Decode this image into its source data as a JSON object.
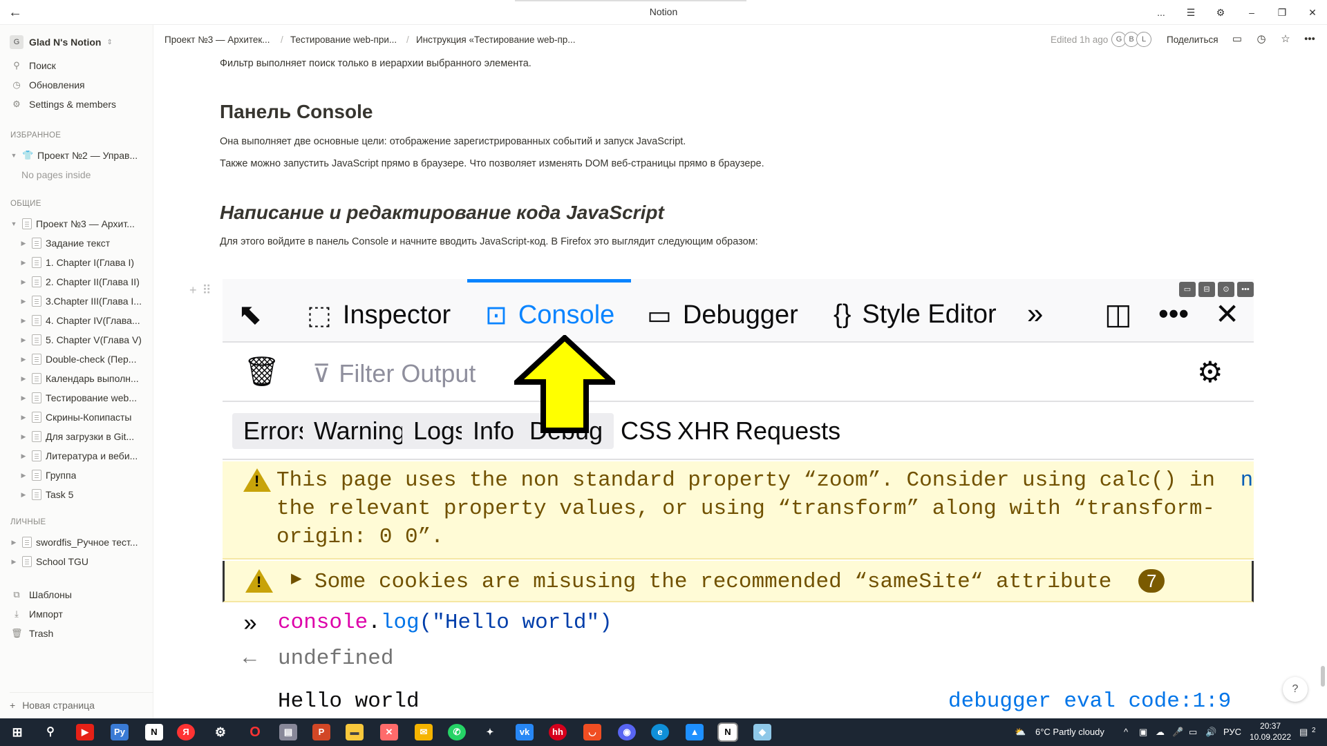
{
  "window": {
    "title": "Notion",
    "controls": [
      "...",
      "☰",
      "⚙",
      "–",
      "❐",
      "✕"
    ]
  },
  "sidebar": {
    "workspace_initial": "G",
    "workspace_name": "Glad N's Notion",
    "nav": [
      {
        "label": "Поиск",
        "icon": "search-icon"
      },
      {
        "label": "Обновления",
        "icon": "clock-icon"
      },
      {
        "label": "Settings & members",
        "icon": "gear-icon"
      }
    ],
    "favorites_header": "ИЗБРАННОЕ",
    "favorites": [
      {
        "label": "Проект №2 — Управ..."
      }
    ],
    "no_pages": "No pages inside",
    "shared_header": "ОБЩИЕ",
    "shared_root": "Проект №3 — Архит...",
    "shared_children": [
      "Задание текст",
      "1. Chapter I(Глава I)",
      "2. Chapter II(Глава II)",
      "3.Chapter III(Глава I...",
      "4. Chapter IV(Глава...",
      "5. Chapter V(Глава V)",
      "Double-check (Пер...",
      "Календарь выполн...",
      "Тестирование web...",
      "Скрины-Копипасты",
      "Для загрузки в Git...",
      "Литература и веби...",
      "Группа",
      "Task 5"
    ],
    "private_header": "ЛИЧНЫЕ",
    "private": [
      "swordfis_Ручное тест...",
      "School TGU"
    ],
    "bottom": [
      {
        "label": "Шаблоны",
        "icon": "templates-icon"
      },
      {
        "label": "Импорт",
        "icon": "import-icon"
      },
      {
        "label": "Trash",
        "icon": "trash-icon"
      }
    ],
    "new_page": "Новая страница"
  },
  "topbar": {
    "breadcrumbs": [
      "Проект №3 — Архитек...",
      "Тестирование web-при...",
      "Инструкция «Тестирование web-пр..."
    ],
    "separator": "/",
    "edited": "Edited 1h ago",
    "avatars": [
      "G",
      "B",
      "L"
    ],
    "share": "Поделиться"
  },
  "content": {
    "p_filter": "Фильтр выполняет поиск только в иерархии выбранного элемента.",
    "h_console": "Панель Console",
    "p_goals": "Она выполняет две основные цели: отображение зарегистрированных событий и запуск JavaScript.",
    "p_run": "Также можно запустить JavaScript прямо в браузере. Что позволяет изменять DOM веб-страницы прямо в браузере.",
    "h_writing": "Написание и редактирование кода JavaScript",
    "p_firefox": "Для этого войдите в панель Console и начните вводить JavaScript-код. В Firefox это выглядит следующим образом:"
  },
  "devtools": {
    "tabs": [
      "Inspector",
      "Console",
      "Debugger",
      "Style Editor"
    ],
    "active_tab": "Console",
    "filter_placeholder": "Filter Output",
    "categories_active": [
      "Errors",
      "Warnings",
      "Logs",
      "Info",
      "Debug"
    ],
    "categories_plain": [
      "CSS",
      "XHR",
      "Requests"
    ],
    "warning1_line1": "This page uses the non standard property “zoom”. Consider using calc() in",
    "warning1_link": "new",
    "warning1_line2": "the relevant property values, or using “transform” along with “transform-",
    "warning1_line3": "origin: 0 0”.",
    "warning2": "Some cookies are misusing the recommended “sameSite“ attribute",
    "warning2_count": "7",
    "input_obj": "console",
    "input_dot": ".",
    "input_fn": "log",
    "input_args": "(\"Hello world\")",
    "return_value": "undefined",
    "output": "Hello world",
    "output_source": "debugger eval code:1:9",
    "colors": {
      "accent": "#0a84ff",
      "warning_bg": "#fffbd6",
      "arrow": "#ffff00"
    }
  },
  "help": "?",
  "taskbar": {
    "weather": "6°C  Partly cloudy",
    "lang": "РУС",
    "time": "20:37",
    "date": "10.09.2022",
    "notifications": "2"
  }
}
